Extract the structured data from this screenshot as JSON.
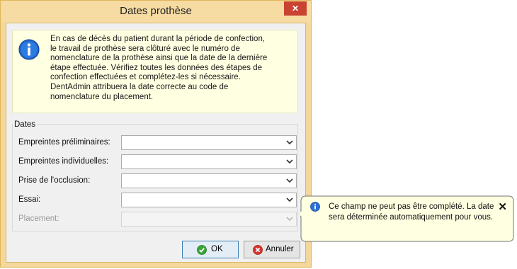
{
  "window": {
    "title": "Dates prothèse",
    "close_icon": "close-icon"
  },
  "info": {
    "icon": "info-icon",
    "text": "En cas de décès du patient durant la période de confection,\nle travail de prothèse sera clôturé avec le numéro de\nnomenclature de la prothèse ainsi que la date de la dernière\nétape effectuée. Vérifiez toutes les données des étapes de\nconfection effectuées et complétez-les si nécessaire.\nDentAdmin attribuera la date correcte au code de\nnomenclature du placement."
  },
  "dates": {
    "group_title": "Dates",
    "fields": [
      {
        "label": "Empreintes préliminaires:",
        "value": "",
        "enabled": true
      },
      {
        "label": "Empreintes individuelles:",
        "value": "",
        "enabled": true
      },
      {
        "label": "Prise de l'occlusion:",
        "value": "",
        "enabled": true
      },
      {
        "label": "Essai:",
        "value": "",
        "enabled": true
      },
      {
        "label": "Placement:",
        "value": "",
        "enabled": false
      }
    ]
  },
  "buttons": {
    "ok_label": "OK",
    "ok_icon": "check-icon",
    "cancel_label": "Annuler",
    "cancel_icon": "cancel-icon"
  },
  "tooltip": {
    "icon": "info-icon",
    "text": "Ce champ ne peut pas être complété. La date sera déterminée automatiquement pour vous.",
    "close_icon": "close-icon"
  },
  "colors": {
    "title_bar": "#f6dba2",
    "close_button": "#c84332",
    "info_background": "#ffffe1",
    "tooltip_background": "#ffffe1"
  }
}
